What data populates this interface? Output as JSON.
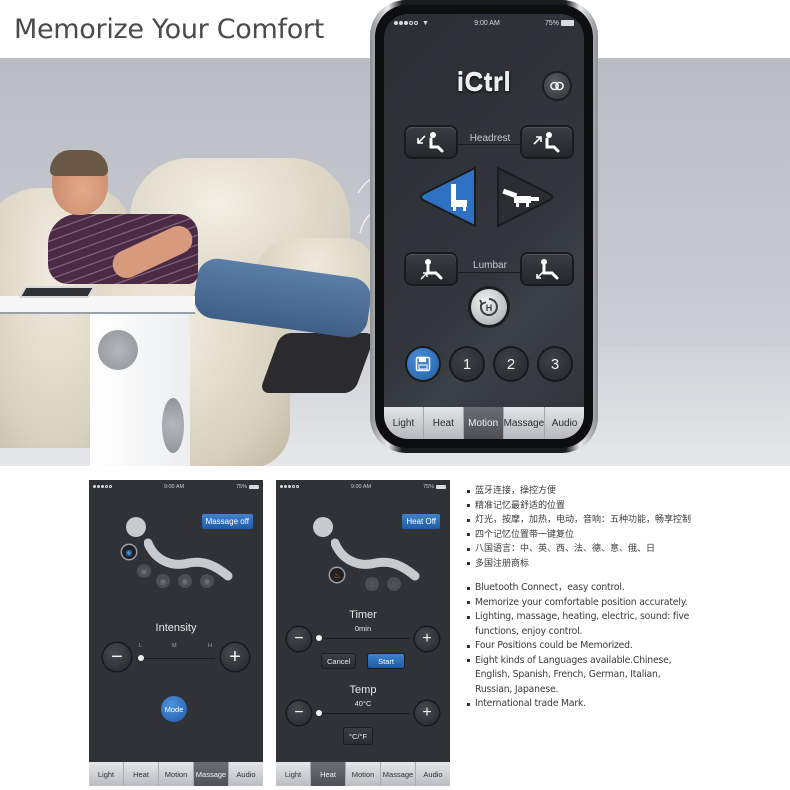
{
  "header": {
    "title": "Memorize Your Comfort"
  },
  "hero": {
    "description": "man-on-recliner-with-phone"
  },
  "main_phone": {
    "status": {
      "time": "9:00 AM",
      "battery": "75%",
      "signal_dots_filled": 3,
      "signal_dots_total": 5
    },
    "app_logo": "iCtrl",
    "link_icon": "link-rings-icon",
    "headrest": {
      "label": "Headrest",
      "down_icon": "recline-arrow-down-left-icon",
      "up_icon": "recline-arrow-up-right-icon"
    },
    "position_presets": {
      "left": "upright-position-icon",
      "right": "flat-position-icon",
      "active": "left"
    },
    "lumbar": {
      "label": "Lumbar",
      "up_icon": "lumbar-arrow-up-icon",
      "down_icon": "lumbar-arrow-down-icon"
    },
    "reset": {
      "label": "H",
      "icon": "home-reset-icon"
    },
    "memory": {
      "save_icon": "floppy-save-icon",
      "slots": [
        "1",
        "2",
        "3"
      ]
    },
    "tabs": [
      {
        "label": "Light",
        "active": false
      },
      {
        "label": "Heat",
        "active": false
      },
      {
        "label": "Motion",
        "active": true
      },
      {
        "label": "Massage",
        "active": false
      },
      {
        "label": "Audio",
        "active": false
      }
    ]
  },
  "massage_phone": {
    "status": {
      "time": "9:00 AM",
      "battery": "75%"
    },
    "toggle_label": "Massage off",
    "zones_active": 1,
    "zones_total": 5,
    "intensity": {
      "label": "Intensity",
      "ticks": [
        "L",
        "M",
        "H"
      ],
      "value": "L",
      "minus": "−",
      "plus": "+"
    },
    "mode_label": "Mode",
    "tabs": [
      {
        "label": "Light",
        "active": false
      },
      {
        "label": "Heat",
        "active": false
      },
      {
        "label": "Motion",
        "active": false
      },
      {
        "label": "Massage",
        "active": true
      },
      {
        "label": "Audio",
        "active": false
      }
    ]
  },
  "heat_phone": {
    "status": {
      "time": "9:00 AM",
      "battery": "75%"
    },
    "toggle_label": "Heat Off",
    "zones_active": 1,
    "zones_total": 3,
    "timer": {
      "label": "Timer",
      "value": "0min",
      "minus": "−",
      "plus": "+",
      "cancel": "Cancel",
      "start": "Start"
    },
    "temp": {
      "label": "Temp",
      "value": "40°C",
      "minus": "−",
      "plus": "+",
      "unit_toggle": "°C/°F"
    },
    "tabs": [
      {
        "label": "Light",
        "active": false
      },
      {
        "label": "Heat",
        "active": true
      },
      {
        "label": "Motion",
        "active": false
      },
      {
        "label": "Massage",
        "active": false
      },
      {
        "label": "Audio",
        "active": false
      }
    ]
  },
  "features": {
    "zh": [
      "蓝牙连接，操控方便",
      "精准记忆最舒适的位置",
      "灯光，按摩，加热，电动，音响：五种功能，畅享控制",
      "四个记忆位置带一键复位",
      "八国语言：中、英、西、法、德、意、俄、日",
      "多国注册商标"
    ],
    "en": [
      "Bluetooth Connect，easy control.",
      "Memorize your comfortable position accurately.",
      "Lighting, massage, heating, electric, sound: five functions, enjoy control.",
      "Four Positions could be Memorized.",
      "Eight kinds of Languages available.Chinese, English, Spanish, French, German, Italian, Russian, Japanese.",
      "International trade Mark."
    ]
  },
  "colors": {
    "accent_blue": "#2a6bbd",
    "heat_orange": "#e5782a",
    "screen_bg": "#2f3236"
  }
}
